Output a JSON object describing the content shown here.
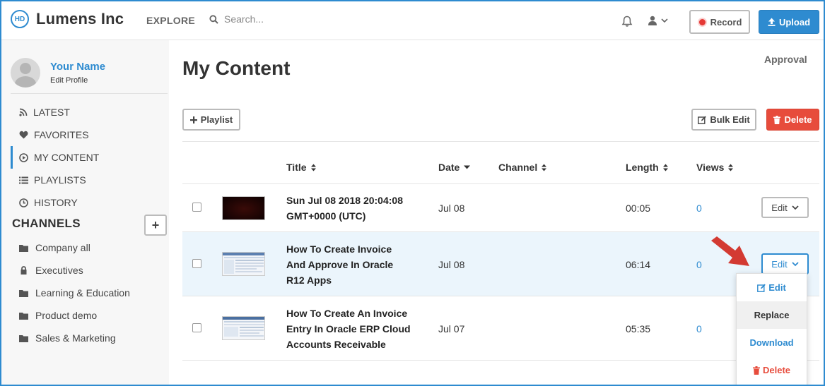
{
  "header": {
    "logo_mark": "HD",
    "brand": "Lumens Inc",
    "explore": "EXPLORE",
    "search_placeholder": "Search...",
    "record_label": "Record",
    "upload_label": "Upload"
  },
  "sidebar": {
    "profile_name": "Your Name",
    "profile_edit": "Edit Profile",
    "nav": [
      {
        "label": "LATEST",
        "icon": "rss-icon"
      },
      {
        "label": "FAVORITES",
        "icon": "heart-icon"
      },
      {
        "label": "MY CONTENT",
        "icon": "play-circle-icon",
        "active": true
      },
      {
        "label": "PLAYLISTS",
        "icon": "list-icon"
      },
      {
        "label": "HISTORY",
        "icon": "clock-icon"
      }
    ],
    "channels_heading": "CHANNELS",
    "add_channel": "+",
    "channels": [
      {
        "label": "Company all",
        "icon": "folder-icon"
      },
      {
        "label": "Executives",
        "icon": "lock-icon"
      },
      {
        "label": "Learning & Education",
        "icon": "folder-icon"
      },
      {
        "label": "Product demo",
        "icon": "folder-icon"
      },
      {
        "label": "Sales & Marketing",
        "icon": "folder-icon"
      }
    ]
  },
  "main": {
    "title": "My Content",
    "approval": "Approval",
    "playlist_button": "Playlist",
    "bulk_edit_button": "Bulk Edit",
    "delete_button": "Delete",
    "columns": {
      "title": "Title",
      "date": "Date",
      "channel": "Channel",
      "length": "Length",
      "views": "Views"
    },
    "rows": [
      {
        "title_line1": "Sun Jul 08 2018 20:04:08",
        "title_line2": "GMT+0000 (UTC)",
        "title_line3": "",
        "date": "Jul 08",
        "length": "00:05",
        "views": "0",
        "edit": "Edit"
      },
      {
        "title_line1": "How To Create Invoice",
        "title_line2": "And Approve In Oracle",
        "title_line3": "R12 Apps",
        "date": "Jul 08",
        "length": "06:14",
        "views": "0",
        "edit": "Edit"
      },
      {
        "title_line1": "How To Create An Invoice",
        "title_line2": "Entry In Oracle ERP Cloud",
        "title_line3": "Accounts Receivable",
        "date": "Jul 07",
        "length": "05:35",
        "views": "0",
        "edit": "Edit"
      }
    ],
    "dropdown": {
      "edit": "Edit",
      "replace": "Replace",
      "download": "Download",
      "delete": "Delete"
    }
  },
  "colors": {
    "accent": "#2e8bd0",
    "danger": "#e74c3c",
    "highlight_row": "#ebf5fc",
    "annotation_arrow": "#d33a32"
  }
}
